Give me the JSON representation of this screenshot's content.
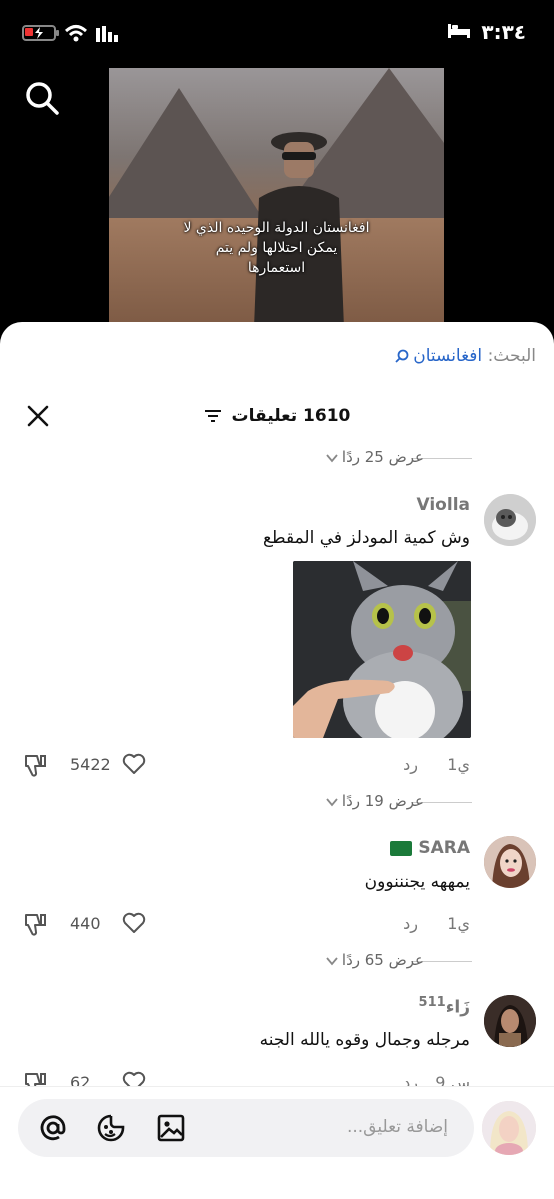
{
  "status_bar": {
    "time": "٣:٣٤"
  },
  "video": {
    "subtitle_lines": [
      "افغانستان الدولة الوحيده الذي لا",
      "يمكن احتلالها ولم يتم",
      "استعمارها"
    ]
  },
  "search": {
    "prefix": "البحث:",
    "term": "افغانستان"
  },
  "header": {
    "comment_count": "1610",
    "comments_label": "تعليقات"
  },
  "comments": [
    {
      "replies_label": "عرض 25 ردًا"
    },
    {
      "username": "Violla",
      "text": "وش كمية المودلز في المقطع",
      "time": "1ي",
      "reply_label": "رد",
      "likes": "5422",
      "replies_label": "عرض 19 ردًا"
    },
    {
      "username": "SARA",
      "flag": "🇸🇦",
      "text": "يمههه يجنننوون",
      "time": "1ي",
      "reply_label": "رد",
      "likes": "440",
      "replies_label": "عرض 65 ردًا"
    },
    {
      "username": "زَاء",
      "username_suffix": "511",
      "text": "مرجله وجمال وقوه يالله الجنه",
      "time": "9 س",
      "reply_label": "رد",
      "likes": "62"
    }
  ],
  "composer": {
    "placeholder": "إضافة تعليق..."
  }
}
